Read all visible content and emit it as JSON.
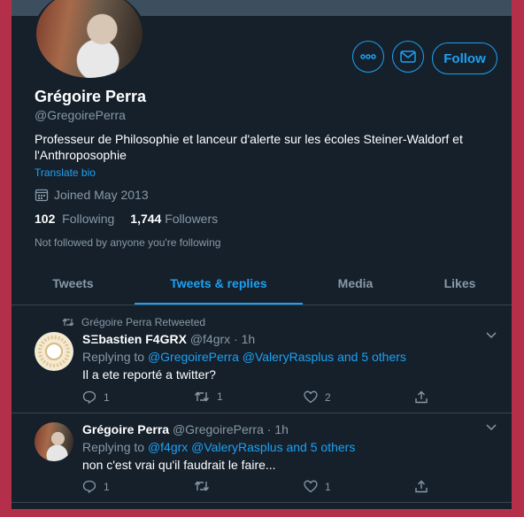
{
  "profile": {
    "name": "Grégoire Perra",
    "handle": "@GregoirePerra",
    "bio": "Professeur de Philosophie et lanceur d'alerte sur les écoles Steiner-Waldorf et l'Anthroposophie",
    "translate_label": "Translate bio",
    "joined": "Joined May 2013",
    "following_count": "102",
    "following_label": "Following",
    "followers_count": "1,744",
    "followers_label": "Followers",
    "not_followed": "Not followed by anyone you're following"
  },
  "buttons": {
    "follow": "Follow"
  },
  "tabs": [
    {
      "label": "Tweets"
    },
    {
      "label": "Tweets & replies",
      "active": true
    },
    {
      "label": "Media"
    },
    {
      "label": "Likes"
    }
  ],
  "tweets": [
    {
      "context": "Grégoire Perra Retweeted",
      "author": "SΞbastien F4GRX",
      "handle": "@f4grx",
      "time": "· 1h",
      "replying_label": "Replying to",
      "replying_to": "@GregoirePerra @ValeryRasplus and 5 others",
      "text": "Il a ete reporté a twitter?",
      "replies": "1",
      "retweets": "1",
      "likes": "2"
    },
    {
      "author": "Grégoire Perra",
      "handle": "@GregoirePerra",
      "time": "· 1h",
      "replying_label": "Replying to",
      "replying_to": "@f4grx @ValeryRasplus and 5 others",
      "text": "non c'est vrai qu'il faudrait le faire...",
      "replies": "1",
      "retweets": "",
      "likes": "1"
    }
  ],
  "colors": {
    "accent": "#1da1f2",
    "background": "#15202b",
    "muted": "#8899a6",
    "border": "#b4304a"
  }
}
